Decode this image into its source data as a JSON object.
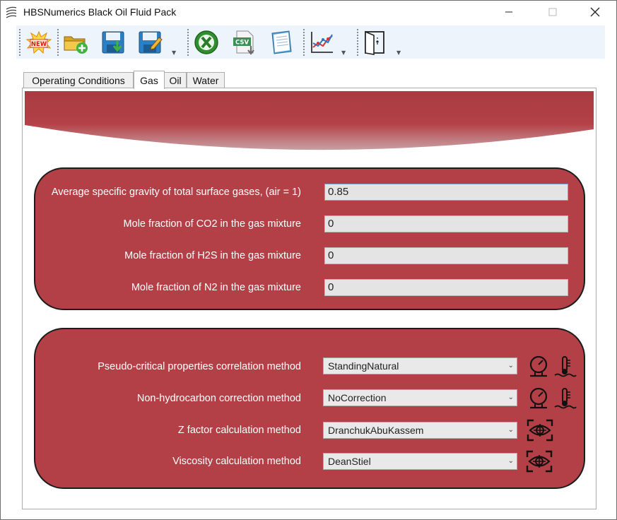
{
  "window": {
    "title": "HBSNumerics Black Oil Fluid Pack"
  },
  "toolbar": {
    "buttons": [
      {
        "name": "new-button",
        "icon": "new-icon"
      },
      {
        "name": "open-button",
        "icon": "open-add-icon"
      },
      {
        "name": "save-button",
        "icon": "save-icon"
      },
      {
        "name": "save-as-button",
        "icon": "save-edit-icon"
      },
      {
        "name": "excel-button",
        "icon": "excel-icon"
      },
      {
        "name": "csv-button",
        "icon": "csv-export-icon",
        "label": "CSV"
      },
      {
        "name": "notes-button",
        "icon": "notepad-icon"
      },
      {
        "name": "chart-button",
        "icon": "line-chart-icon"
      },
      {
        "name": "exit-button",
        "icon": "exit-door-icon"
      }
    ],
    "new_label": "NEW",
    "csv_label": "CSV"
  },
  "tabs": [
    {
      "label": "Operating Conditions",
      "active": false
    },
    {
      "label": "Gas",
      "active": true
    },
    {
      "label": "Oil",
      "active": false
    },
    {
      "label": "Water",
      "active": false
    }
  ],
  "gas_inputs": [
    {
      "label": "Average specific gravity of total surface gases, (air = 1)",
      "value": "0.85"
    },
    {
      "label": "Mole fraction of CO2 in the gas mixture",
      "value": "0"
    },
    {
      "label": "Mole fraction of H2S in the gas mixture",
      "value": "0"
    },
    {
      "label": "Mole fraction of N2 in the gas mixture",
      "value": "0"
    }
  ],
  "methods": [
    {
      "label": "Pseudo-critical properties correlation method",
      "value": "StandingNatural",
      "icons": [
        "pressure-gauge-icon",
        "temperature-icon"
      ]
    },
    {
      "label": "Non-hydrocarbon correction method",
      "value": "NoCorrection",
      "icons": [
        "pressure-gauge-icon",
        "temperature-icon"
      ]
    },
    {
      "label": "Z factor calculation method",
      "value": "DranchukAbuKassem",
      "icons": [
        "view-eye-icon"
      ]
    },
    {
      "label": "Viscosity calculation method",
      "value": "DeanStiel",
      "icons": [
        "view-eye-icon"
      ]
    }
  ],
  "colors": {
    "panel": "#b34046",
    "panel_border": "#1c1c1c",
    "toolbar_bg": "#eef4fb"
  }
}
